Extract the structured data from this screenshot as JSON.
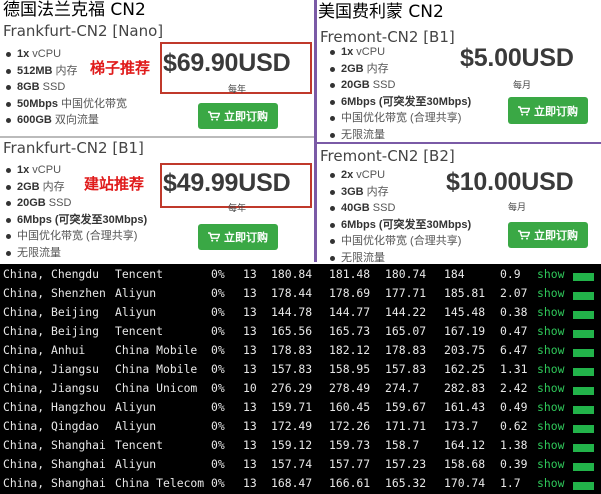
{
  "left_region": "德国法兰克福 CN2",
  "right_region": "美国费利蒙 CN2",
  "plans": [
    {
      "name": "Frankfurt-CN2 [Nano]",
      "specs": [
        [
          "1x",
          " vCPU"
        ],
        [
          "512MB",
          " 内存"
        ],
        [
          "8GB",
          " SSD"
        ],
        [
          "50Mbps",
          " 中国优化带宽"
        ],
        [
          "600GB",
          " 双向流量"
        ]
      ],
      "price": "$69.90USD",
      "period": "每年",
      "recommend": "梯子推荐",
      "buy": "立即订购"
    },
    {
      "name": "Frankfurt-CN2 [B1]",
      "specs": [
        [
          "1x",
          " vCPU"
        ],
        [
          "2GB",
          " 内存"
        ],
        [
          "20GB",
          " SSD"
        ],
        [
          "6Mbps (可突发至30Mbps)",
          ""
        ],
        [
          "",
          "中国优化带宽 (合理共享)"
        ],
        [
          "",
          "无限流量"
        ]
      ],
      "price": "$49.99USD",
      "period": "每年",
      "recommend": "建站推荐",
      "buy": "立即订购"
    },
    {
      "name": "Fremont-CN2 [B1]",
      "specs": [
        [
          "1x",
          " vCPU"
        ],
        [
          "2GB",
          " 内存"
        ],
        [
          "20GB",
          " SSD"
        ],
        [
          "6Mbps (可突发至30Mbps)",
          ""
        ],
        [
          "",
          "中国优化带宽 (合理共享)"
        ],
        [
          "",
          "无限流量"
        ]
      ],
      "price": "$5.00USD",
      "period": "每月",
      "buy": "立即订购"
    },
    {
      "name": "Fremont-CN2 [B2]",
      "specs": [
        [
          "2x",
          " vCPU"
        ],
        [
          "3GB",
          " 内存"
        ],
        [
          "40GB",
          " SSD"
        ],
        [
          "6Mbps (可突发至30Mbps)",
          ""
        ],
        [
          "",
          "中国优化带宽 (合理共享)"
        ],
        [
          "",
          "无限流量"
        ]
      ],
      "price": "$10.00USD",
      "period": "每月",
      "buy": "立即订购"
    }
  ],
  "ping_rows": [
    [
      "China, Chengdu",
      "Tencent",
      "0%",
      "13",
      "180.84",
      "181.48",
      "180.74",
      "184",
      "0.9",
      "show"
    ],
    [
      "China, Shenzhen",
      "Aliyun",
      "0%",
      "13",
      "178.44",
      "178.69",
      "177.71",
      "185.81",
      "2.07",
      "show"
    ],
    [
      "China, Beijing",
      "Aliyun",
      "0%",
      "13",
      "144.78",
      "144.77",
      "144.22",
      "145.48",
      "0.38",
      "show"
    ],
    [
      "China, Beijing",
      "Tencent",
      "0%",
      "13",
      "165.56",
      "165.73",
      "165.07",
      "167.19",
      "0.47",
      "show"
    ],
    [
      "China, Anhui",
      "China Mobile",
      "0%",
      "13",
      "178.83",
      "182.12",
      "178.83",
      "203.75",
      "6.47",
      "show"
    ],
    [
      "China, Jiangsu",
      "China Mobile",
      "0%",
      "13",
      "157.83",
      "158.95",
      "157.83",
      "162.25",
      "1.31",
      "show"
    ],
    [
      "China, Jiangsu",
      "China Unicom",
      "0%",
      "10",
      "276.29",
      "278.49",
      "274.7",
      "282.83",
      "2.42",
      "show"
    ],
    [
      "China, Hangzhou",
      "Aliyun",
      "0%",
      "13",
      "159.71",
      "160.45",
      "159.67",
      "161.43",
      "0.49",
      "show"
    ],
    [
      "China, Qingdao",
      "Aliyun",
      "0%",
      "13",
      "172.49",
      "172.26",
      "171.71",
      "173.7",
      "0.62",
      "show"
    ],
    [
      "China, Shanghai",
      "Tencent",
      "0%",
      "13",
      "159.12",
      "159.73",
      "158.7",
      "164.12",
      "1.38",
      "show"
    ],
    [
      "China, Shanghai",
      "Aliyun",
      "0%",
      "13",
      "157.74",
      "157.77",
      "157.23",
      "158.68",
      "0.39",
      "show"
    ],
    [
      "China, Shanghai",
      "China Telecom",
      "0%",
      "13",
      "168.47",
      "166.61",
      "165.32",
      "170.74",
      "1.7",
      "show"
    ]
  ],
  "colors": {
    "accent_green": "#3aa845",
    "recommend_red": "#e01b1b",
    "divider_purple": "#7a5aa6",
    "show_green": "#2fc85a"
  }
}
